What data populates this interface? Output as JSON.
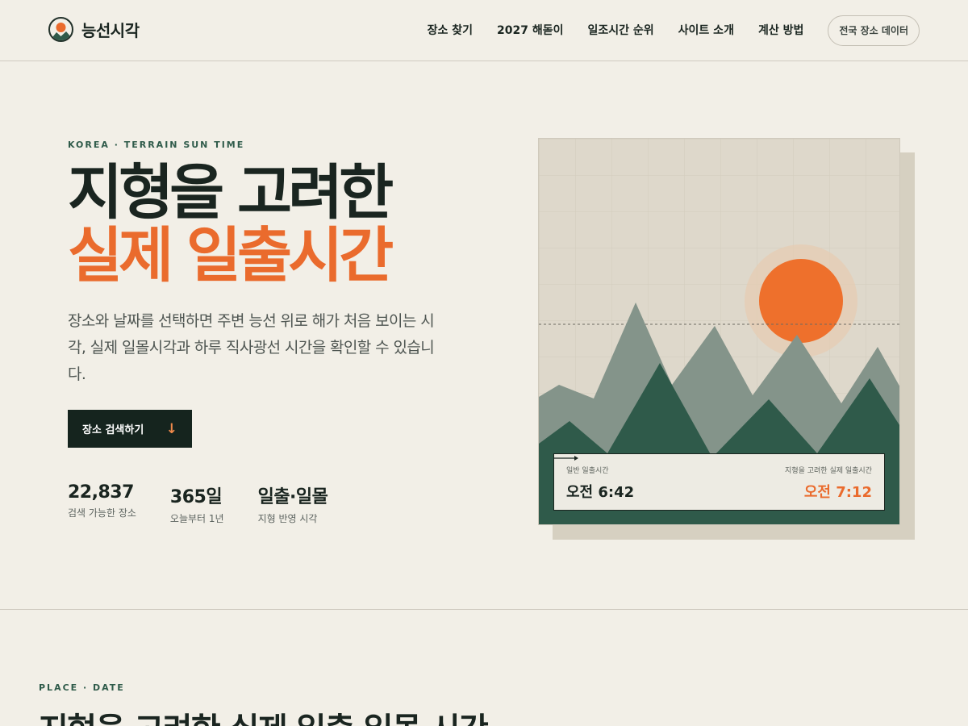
{
  "brand": {
    "name": "능선시각",
    "logo_icon": "sun-over-mountain-icon"
  },
  "nav": {
    "items": [
      "장소 찾기",
      "2027 해돋이",
      "일조시간 순위",
      "사이트 소개",
      "계산 방법"
    ],
    "button_label": "전국 장소 데이터"
  },
  "hero": {
    "eyebrow": "KOREA · TERRAIN SUN TIME",
    "title_line1": "지형을 고려한",
    "title_line2": "실제 일출시간",
    "description": "장소와 날짜를 선택하면 주변 능선 위로 해가 처음 보이는 시각, 실제 일몰시각과 하루 직사광선 시간을 확인할 수 있습니다.",
    "cta_label": "장소 검색하기",
    "cta_icon": "arrow-down-icon"
  },
  "stats": [
    {
      "value": "22,837",
      "label": "검색 가능한 장소"
    },
    {
      "value": "365일",
      "label": "오늘부터 1년"
    },
    {
      "value": "일출·일몰",
      "label": "지형 반영 시각"
    }
  ],
  "illustration": {
    "standard_caption": "일반 일출시간",
    "standard_time": "오전 6:42",
    "terrain_caption": "지형을 고려한 실제 일출시간",
    "terrain_time": "오전 7:12",
    "arrow_icon": "arrow-right-icon"
  },
  "section2": {
    "eyebrow": "PLACE · DATE",
    "title": "지형을 고려한 실제 일출 일몰 시간"
  },
  "colors": {
    "background": "#f2efe7",
    "dark_green": "#15241e",
    "accent_orange": "#ea6b2d",
    "mountain_back": "#84948a",
    "mountain_front": "#2f5a4a"
  }
}
